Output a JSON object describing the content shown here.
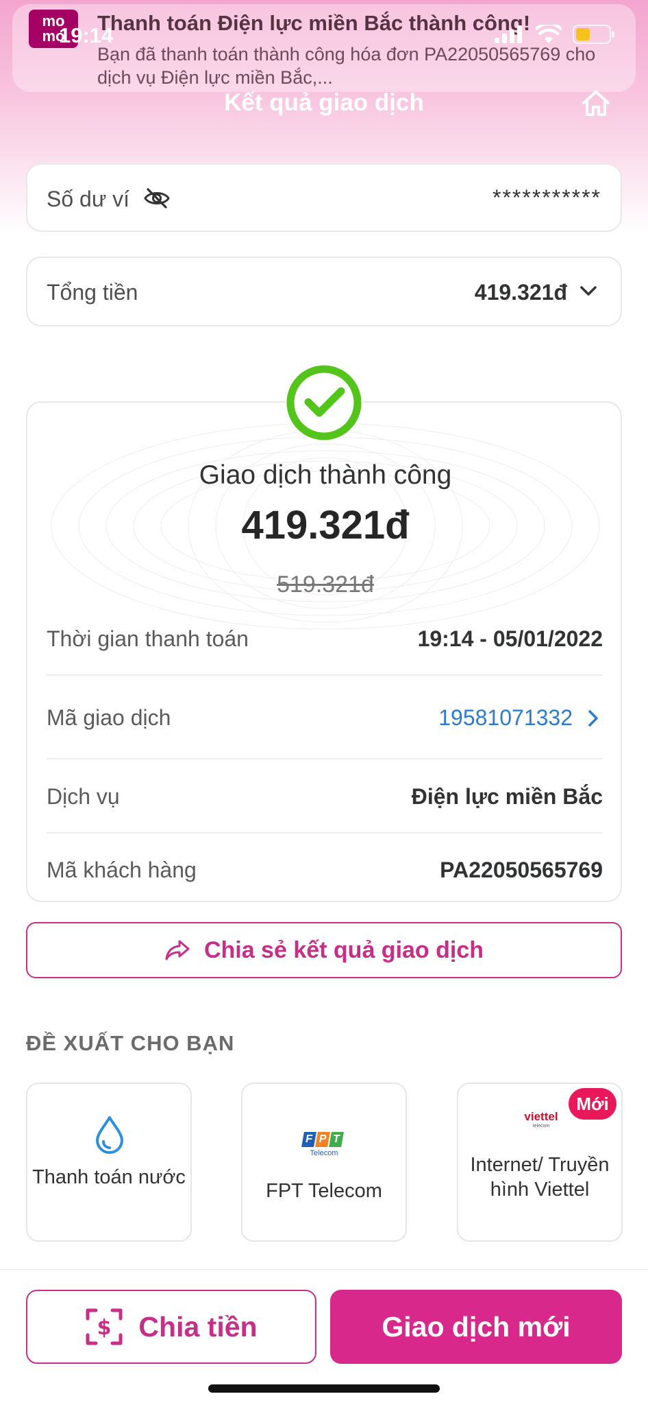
{
  "status_bar": {
    "time": "19:14"
  },
  "notification": {
    "app_logo": "mo mo",
    "title": "Thanh toán Điện lực miền Bắc thành công!",
    "body": "Bạn đã thanh toán thành công hóa đơn PA22050565769 cho dịch vụ Điện lực miền Bắc,..."
  },
  "header": {
    "title": "Kết quả giao dịch"
  },
  "balance": {
    "label": "Số dư ví",
    "value": "***********"
  },
  "total": {
    "label": "Tổng tiền",
    "value": "419.321đ"
  },
  "result": {
    "status": "Giao dịch thành công",
    "amount": "419.321đ",
    "original_amount": "519.321đ",
    "rows": [
      {
        "label": "Thời gian thanh toán",
        "value": "19:14 - 05/01/2022"
      },
      {
        "label": "Mã giao dịch",
        "value": "19581071332"
      },
      {
        "label": "Dịch vụ",
        "value": "Điện lực miền Bắc"
      },
      {
        "label": "Mã khách hàng",
        "value": "PA22050565769"
      }
    ]
  },
  "share": {
    "label": "Chia sẻ kết quả giao dịch"
  },
  "suggestions": {
    "title": "ĐỀ XUẤT CHO BẠN",
    "items": [
      {
        "label": "Thanh toán nước",
        "icon": "water-drop-icon"
      },
      {
        "label": "FPT Telecom",
        "icon": "fpt-telecom-logo",
        "logo_text": "FPT",
        "logo_sub": "Telecom"
      },
      {
        "label": "Internet/ Truyền hình Viettel",
        "icon": "viettel-logo",
        "logo_text": "viettel",
        "logo_sub": "telecom",
        "badge": "Mới"
      }
    ]
  },
  "bottom": {
    "split_label": "Chia tiền",
    "new_label": "Giao dịch mới"
  },
  "colors": {
    "brand": "#d8288b",
    "brand_dark": "#c62e87",
    "success": "#52c41a",
    "link": "#2b7bd1"
  }
}
